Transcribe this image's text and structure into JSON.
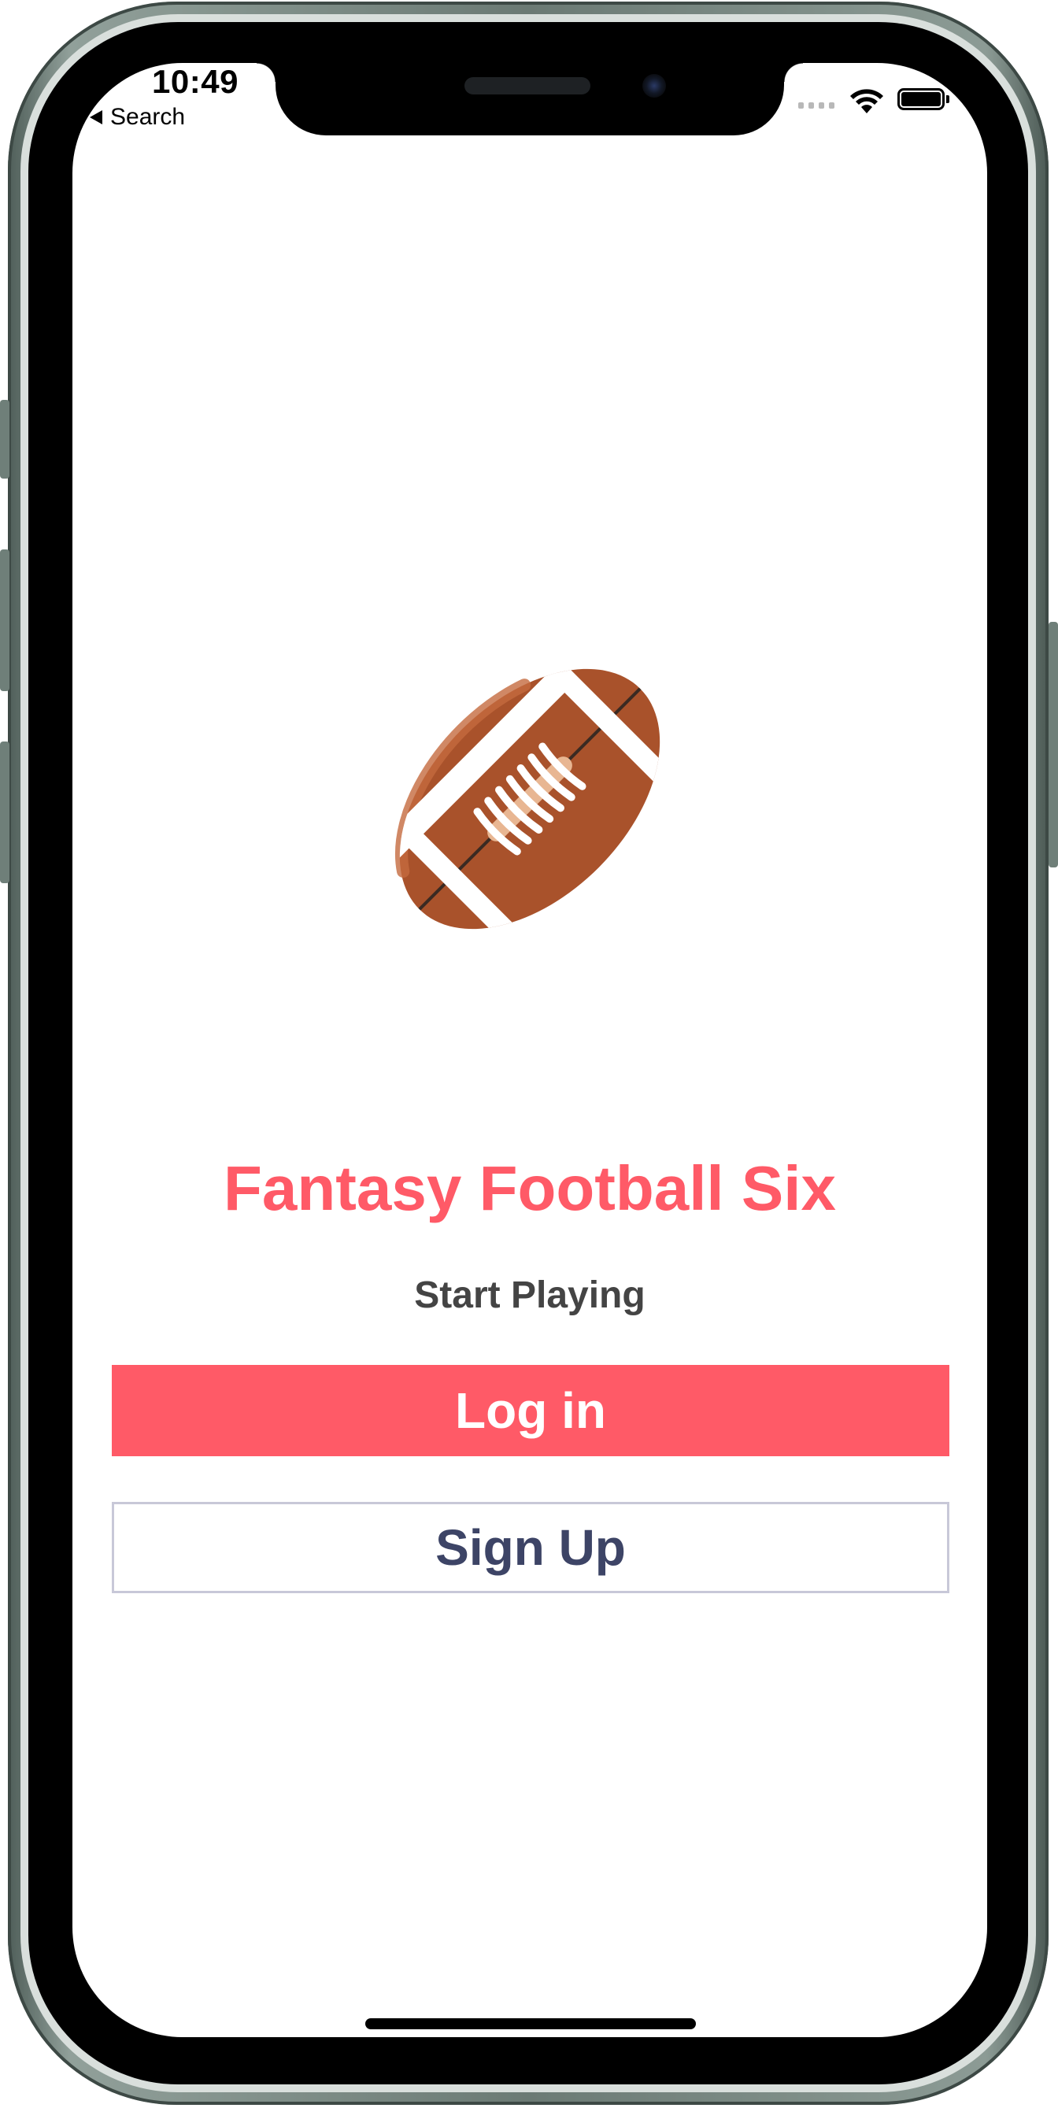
{
  "status_bar": {
    "time": "10:49",
    "back_label": "Search"
  },
  "main": {
    "title": "Fantasy Football Six",
    "subtitle": "Start Playing",
    "login_label": "Log in",
    "signup_label": "Sign Up"
  },
  "icons": {
    "logo": "american-football-icon",
    "back": "back-arrow-icon",
    "signal": "cellular-signal-icon",
    "wifi": "wifi-icon",
    "battery": "battery-icon"
  },
  "colors": {
    "accent": "#ff5a67",
    "subtitle_text": "#444444",
    "signup_text": "#3d4466",
    "signup_border": "#c8c8d8",
    "football_brown": "#a9522b",
    "phone_frame": "#6b7a74"
  }
}
